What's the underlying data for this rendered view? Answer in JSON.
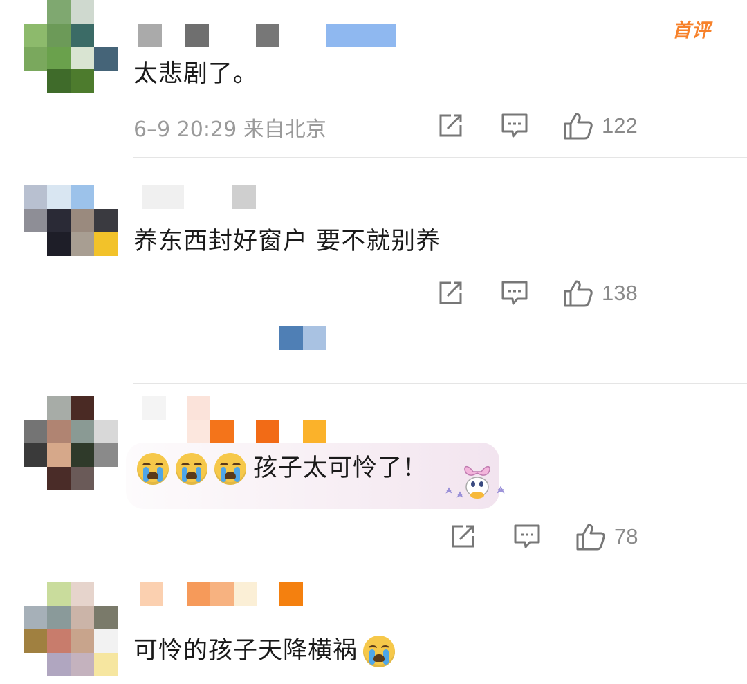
{
  "badge": "首评",
  "comments": [
    {
      "text": "太悲剧了。",
      "meta": "6–9 20:29 来自北京",
      "likes": "122"
    },
    {
      "text": "养东西封好窗户 要不就别养",
      "meta": "",
      "likes": "138"
    },
    {
      "text": "孩子太可怜了！",
      "meta": "",
      "likes": "78",
      "leading_emoji": [
        "crying-face",
        "crying-face",
        "crying-face"
      ]
    },
    {
      "text": "可怜的孩子天降横祸",
      "meta": "",
      "likes": "",
      "trailing_emoji": [
        "crying-face"
      ]
    }
  ],
  "icons": [
    "share-icon",
    "comment-icon",
    "like-icon"
  ],
  "colors": {
    "badge": "#f7812a",
    "text": "#1a1a1a",
    "meta": "#9a9a9a"
  }
}
